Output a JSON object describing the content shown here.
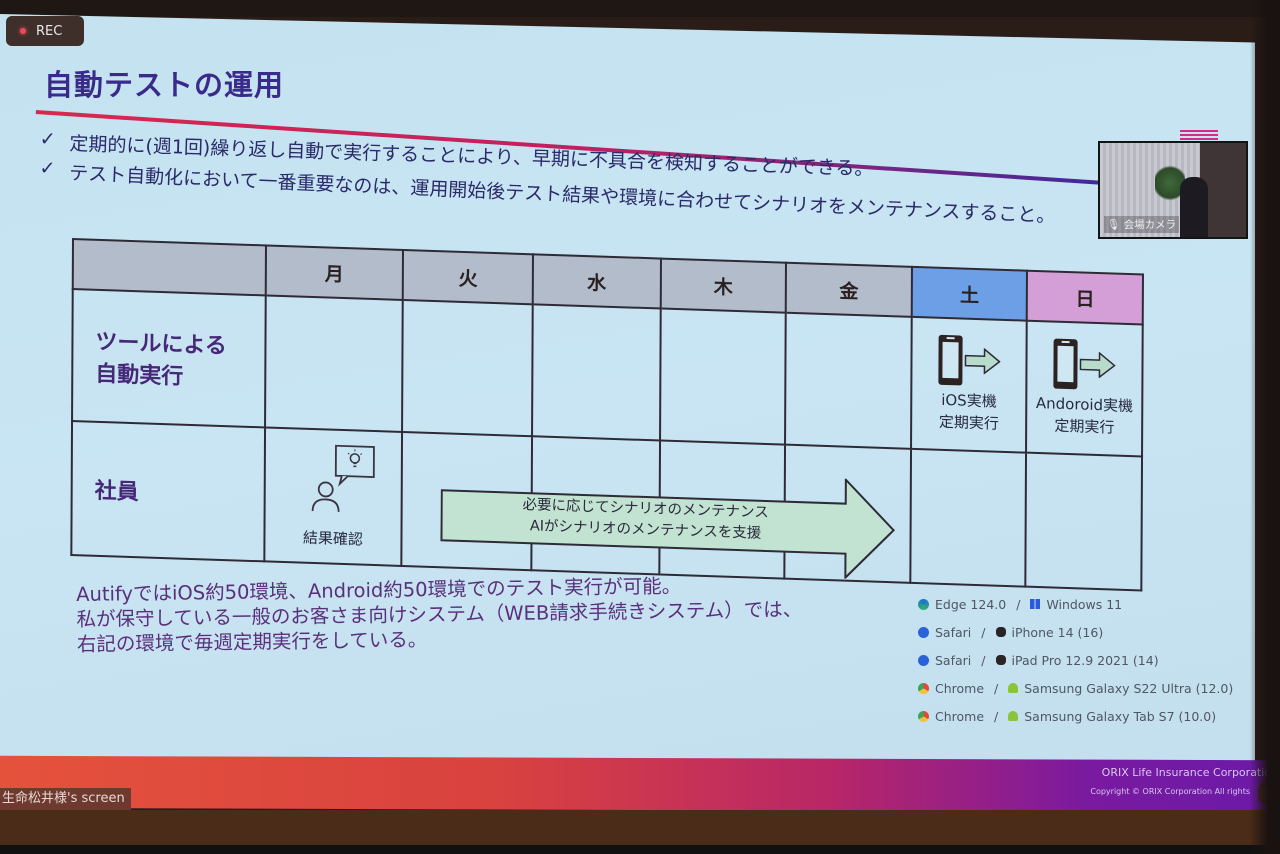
{
  "recording": {
    "label": "REC",
    "color": "#e84a5a"
  },
  "slide": {
    "title": "自動テストの運用",
    "bullets": [
      {
        "check": "✓",
        "text": "定期的に(週1回)繰り返し自動で実行することにより、早期に不具合を検知することができる。"
      },
      {
        "check": "✓",
        "text": "テスト自動化において一番重要なのは、運用開始後テスト結果や環境に合わせてシナリオをメンテナンスすること。"
      }
    ],
    "schedule": {
      "days": [
        "月",
        "火",
        "水",
        "木",
        "金",
        "土",
        "日"
      ],
      "day_colors": {
        "weekday": "#b3bccb",
        "sat": "#6d9fe6",
        "sun": "#d49fd6"
      },
      "rows": [
        {
          "label_line1": "ツールによる",
          "label_line2": "自動実行",
          "sat": {
            "line1": "iOS実機",
            "line2": "定期実行",
            "icon": "smartphone-icon"
          },
          "sun": {
            "line1": "Andoroid実機",
            "line2": "定期実行",
            "icon": "smartphone-icon"
          }
        },
        {
          "label": "社員",
          "mon": {
            "caption": "結果確認",
            "icon": "person-idea-icon"
          },
          "arrow": {
            "line1": "必要に応じてシナリオのメンテナンス",
            "line2": "AIがシナリオのメンテナンスを支援",
            "spans": [
              "火",
              "水",
              "木",
              "金"
            ]
          }
        }
      ]
    },
    "notes": [
      "AutifyではiOS約50環境、Android約50環境でのテスト実行が可能。",
      "私が保守している一般のお客さま向けシステム（WEB請求手続きシステム）では、",
      "右記の環境で毎週定期実行をしている。"
    ],
    "environments": [
      {
        "browser": "Edge 124.0",
        "browser_icon": "edge-icon",
        "sep": "/",
        "os_icon": "windows-icon",
        "device": "Windows 11"
      },
      {
        "browser": "Safari",
        "browser_icon": "safari-icon",
        "sep": "/",
        "os_icon": "apple-icon",
        "device": "iPhone 14 (16)"
      },
      {
        "browser": "Safari",
        "browser_icon": "safari-icon",
        "sep": "/",
        "os_icon": "apple-icon",
        "device": "iPad Pro 12.9 2021 (14)"
      },
      {
        "browser": "Chrome",
        "browser_icon": "chrome-icon",
        "sep": "/",
        "os_icon": "android-icon",
        "device": "Samsung Galaxy S22 Ultra (12.0)"
      },
      {
        "browser": "Chrome",
        "browser_icon": "chrome-icon",
        "sep": "/",
        "os_icon": "android-icon",
        "device": "Samsung Galaxy Tab S7 (10.0)"
      }
    ],
    "footer": {
      "company": "ORIX Life Insurance Corporation",
      "copyright": "Copyright © ORIX Corporation All rights"
    }
  },
  "camera": {
    "label": "会場カメラ"
  },
  "screen_share": {
    "label": "生命松井様's screen"
  },
  "participants": {
    "icon": "participants-icon"
  }
}
